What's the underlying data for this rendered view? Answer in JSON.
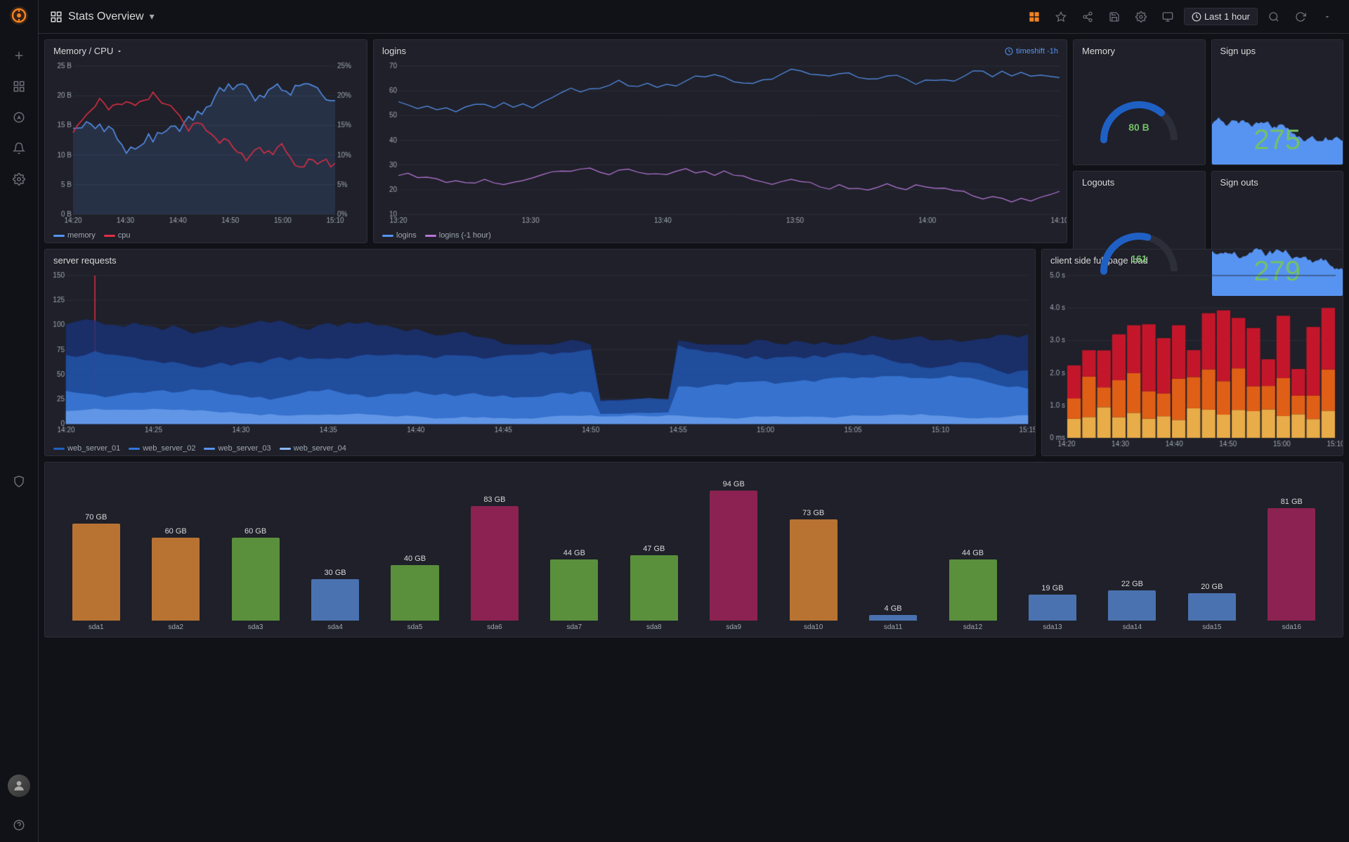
{
  "app": {
    "title": "Stats Overview",
    "logo_color": "#f58220"
  },
  "topbar": {
    "title": "Stats Overview",
    "dropdown_arrow": "▾",
    "time_label": "Last 1 hour",
    "icons": [
      "chart-bar",
      "star",
      "share",
      "save",
      "settings",
      "monitor",
      "clock",
      "search",
      "refresh",
      "chevron-down"
    ]
  },
  "panels": {
    "memory_cpu": {
      "title": "Memory / CPU",
      "legend": [
        {
          "label": "memory",
          "color": "#5794f2"
        },
        {
          "label": "cpu",
          "color": "#e02f44"
        }
      ]
    },
    "logins": {
      "title": "logins",
      "timeshift": "timeshift -1h",
      "legend": [
        {
          "label": "logins",
          "color": "#5794f2"
        },
        {
          "label": "logins (-1 hour)",
          "color": "#b877d9"
        }
      ]
    },
    "memory": {
      "title": "Memory",
      "value": "80 B",
      "gauge_pct": 0.72
    },
    "signups": {
      "title": "Sign ups",
      "value": "275"
    },
    "logouts": {
      "title": "Logouts",
      "value": "161",
      "gauge_pct": 0.58
    },
    "signouts": {
      "title": "Sign outs",
      "value": "279"
    },
    "server_requests": {
      "title": "server requests",
      "legend": [
        {
          "label": "web_server_01",
          "color": "#1f60c4"
        },
        {
          "label": "web_server_02",
          "color": "#3274d9"
        },
        {
          "label": "web_server_03",
          "color": "#5794f2"
        },
        {
          "label": "web_server_04",
          "color": "#8ab8ff"
        }
      ]
    },
    "client_load": {
      "title": "client side full page load"
    }
  },
  "disk": {
    "bars": [
      {
        "name": "sda1",
        "value": 70,
        "label": "70 GB",
        "color": "#b87333"
      },
      {
        "name": "sda2",
        "value": 60,
        "label": "60 GB",
        "color": "#b87333"
      },
      {
        "name": "sda3",
        "value": 60,
        "label": "60 GB",
        "color": "#5a8f3c"
      },
      {
        "name": "sda4",
        "value": 30,
        "label": "30 GB",
        "color": "#4a72b0"
      },
      {
        "name": "sda5",
        "value": 40,
        "label": "40 GB",
        "color": "#5a8f3c"
      },
      {
        "name": "sda6",
        "value": 83,
        "label": "83 GB",
        "color": "#8b2252"
      },
      {
        "name": "sda7",
        "value": 44,
        "label": "44 GB",
        "color": "#5a8f3c"
      },
      {
        "name": "sda8",
        "value": 47,
        "label": "47 GB",
        "color": "#5a8f3c"
      },
      {
        "name": "sda9",
        "value": 94,
        "label": "94 GB",
        "color": "#8b2252"
      },
      {
        "name": "sda10",
        "value": 73,
        "label": "73 GB",
        "color": "#b87333"
      },
      {
        "name": "sda11",
        "value": 4,
        "label": "4 GB",
        "color": "#4a72b0"
      },
      {
        "name": "sda12",
        "value": 44,
        "label": "44 GB",
        "color": "#5a8f3c"
      },
      {
        "name": "sda13",
        "value": 19,
        "label": "19 GB",
        "color": "#4a72b0"
      },
      {
        "name": "sda14",
        "value": 22,
        "label": "22 GB",
        "color": "#4a72b0"
      },
      {
        "name": "sda15",
        "value": 20,
        "label": "20 GB",
        "color": "#4a72b0"
      },
      {
        "name": "sda16",
        "value": 81,
        "label": "81 GB",
        "color": "#8b2252"
      }
    ],
    "max_value": 100
  },
  "sidebar": {
    "items": [
      {
        "id": "add",
        "icon": "plus"
      },
      {
        "id": "dashboard",
        "icon": "grid"
      },
      {
        "id": "explore",
        "icon": "compass"
      },
      {
        "id": "alerts",
        "icon": "bell"
      },
      {
        "id": "settings",
        "icon": "gear"
      },
      {
        "id": "shield",
        "icon": "shield"
      }
    ]
  }
}
